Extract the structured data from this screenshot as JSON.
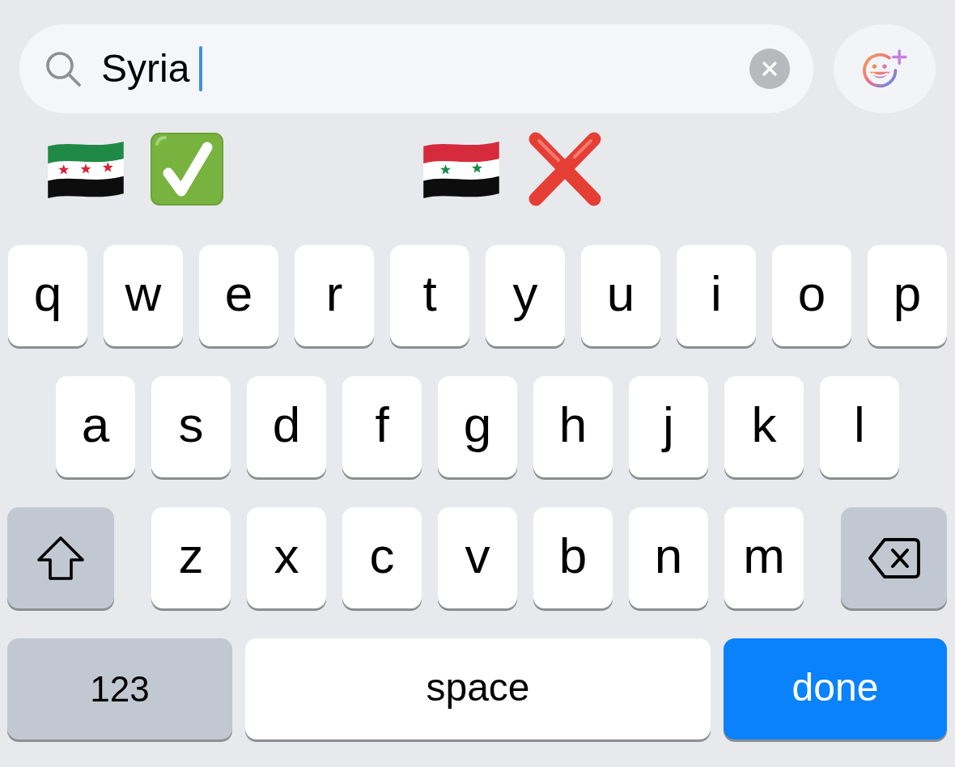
{
  "search": {
    "value": "Syria",
    "focused": true
  },
  "emoji_suggestions": [
    {
      "emoji": [
        {
          "kind": "flag-three-star"
        },
        {
          "kind": "check"
        }
      ]
    },
    {
      "emoji": [
        {
          "kind": "flag-two-star"
        },
        {
          "kind": "cross"
        }
      ]
    }
  ],
  "keyboard": {
    "rows": [
      {
        "keys": [
          {
            "kind": "letter",
            "label": "q"
          },
          {
            "kind": "letter",
            "label": "w"
          },
          {
            "kind": "letter",
            "label": "e"
          },
          {
            "kind": "letter",
            "label": "r"
          },
          {
            "kind": "letter",
            "label": "t"
          },
          {
            "kind": "letter",
            "label": "y"
          },
          {
            "kind": "letter",
            "label": "u"
          },
          {
            "kind": "letter",
            "label": "i"
          },
          {
            "kind": "letter",
            "label": "o"
          },
          {
            "kind": "letter",
            "label": "p"
          }
        ]
      },
      {
        "keys": [
          {
            "kind": "letter",
            "label": "a"
          },
          {
            "kind": "letter",
            "label": "s"
          },
          {
            "kind": "letter",
            "label": "d"
          },
          {
            "kind": "letter",
            "label": "f"
          },
          {
            "kind": "letter",
            "label": "g"
          },
          {
            "kind": "letter",
            "label": "h"
          },
          {
            "kind": "letter",
            "label": "j"
          },
          {
            "kind": "letter",
            "label": "k"
          },
          {
            "kind": "letter",
            "label": "l"
          }
        ]
      },
      {
        "keys": [
          {
            "kind": "shift",
            "on": false
          },
          {
            "kind": "letter",
            "label": "z"
          },
          {
            "kind": "letter",
            "label": "x"
          },
          {
            "kind": "letter",
            "label": "c"
          },
          {
            "kind": "letter",
            "label": "v"
          },
          {
            "kind": "letter",
            "label": "b"
          },
          {
            "kind": "letter",
            "label": "n"
          },
          {
            "kind": "letter",
            "label": "m"
          },
          {
            "kind": "delete"
          }
        ]
      },
      {
        "keys": [
          {
            "kind": "mode",
            "label": "123"
          },
          {
            "kind": "space",
            "label": "space"
          },
          {
            "kind": "return",
            "label": "done"
          }
        ]
      }
    ]
  }
}
